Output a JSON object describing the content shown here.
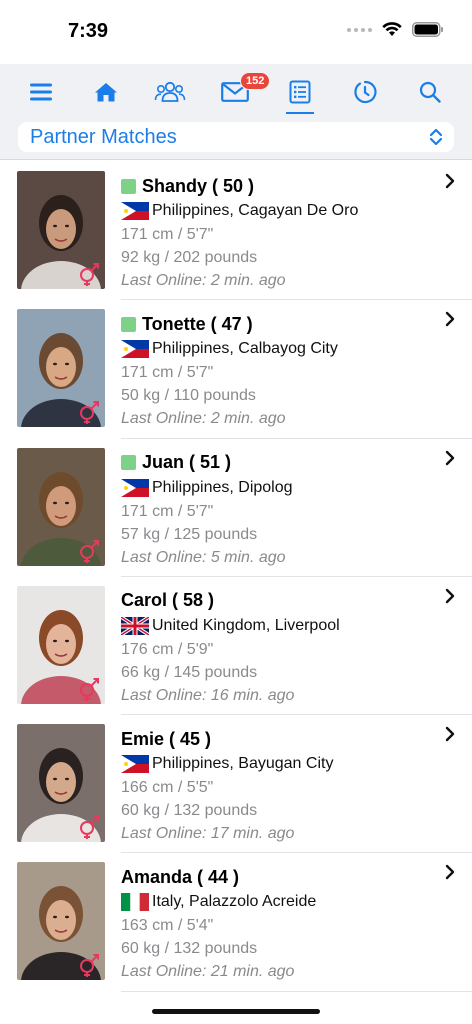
{
  "status_bar": {
    "time": "7:39"
  },
  "toolbar": {
    "icons": [
      "menu-icon",
      "home-icon",
      "group-icon",
      "mail-icon",
      "list-icon",
      "history-icon",
      "search-icon"
    ],
    "mail_badge": "152",
    "accent_color": "#1b7ee8"
  },
  "selector": {
    "label": "Partner Matches"
  },
  "matches": [
    {
      "name": "Shandy ( 50 )",
      "online": true,
      "flag": "philippines",
      "location": "Philippines, Cagayan De Oro",
      "height": "171 cm / 5'7\"",
      "weight": "92 kg / 202 pounds",
      "last_online": "Last Online: 2 min. ago"
    },
    {
      "name": "Tonette ( 47 )",
      "online": true,
      "flag": "philippines",
      "location": "Philippines, Calbayog City",
      "height": "171 cm / 5'7\"",
      "weight": "50 kg / 110 pounds",
      "last_online": "Last Online: 2 min. ago"
    },
    {
      "name": "Juan ( 51 )",
      "online": true,
      "flag": "philippines",
      "location": "Philippines, Dipolog",
      "height": "171 cm / 5'7\"",
      "weight": "57 kg / 125 pounds",
      "last_online": "Last Online: 5 min. ago"
    },
    {
      "name": "Carol ( 58 )",
      "online": false,
      "flag": "uk",
      "location": "United Kingdom, Liverpool",
      "height": "176 cm / 5'9\"",
      "weight": "66 kg / 145 pounds",
      "last_online": "Last Online: 16 min. ago"
    },
    {
      "name": "Emie ( 45 )",
      "online": false,
      "flag": "philippines",
      "location": "Philippines, Bayugan City",
      "height": "166 cm / 5'5\"",
      "weight": "60 kg / 132 pounds",
      "last_online": "Last Online: 17 min. ago"
    },
    {
      "name": "Amanda ( 44 )",
      "online": false,
      "flag": "italy",
      "location": "Italy, Palazzolo Acreide",
      "height": "163 cm / 5'4\"",
      "weight": "60 kg / 132 pounds",
      "last_online": "Last Online: 21 min. ago"
    }
  ]
}
